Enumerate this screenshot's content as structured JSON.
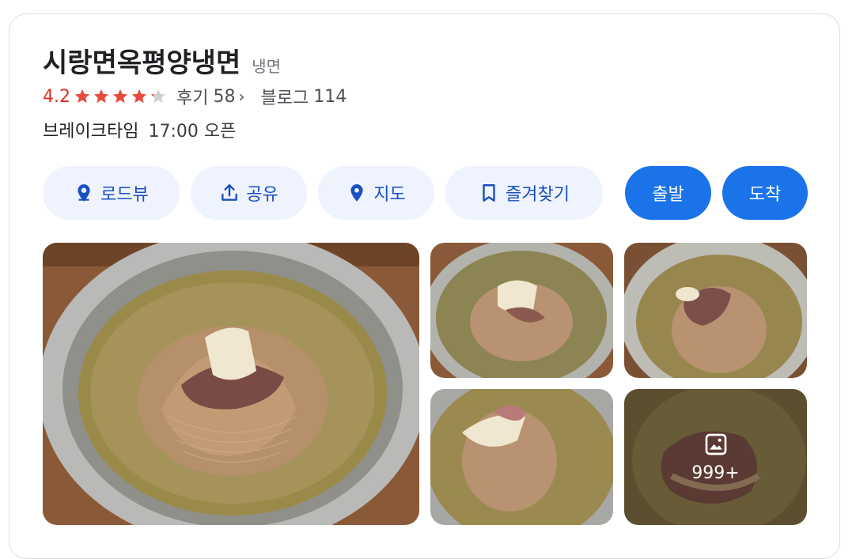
{
  "place": {
    "name": "시랑면옥평양냉면",
    "category": "냉면",
    "rating": "4.2",
    "rating_value": 4.2,
    "reviews_label": "후기",
    "reviews_count": "58",
    "blog_label": "블로그",
    "blog_count": "114",
    "hours_label": "브레이크타임",
    "hours_value": "17:00 오픈"
  },
  "actions": {
    "roadview": "로드뷰",
    "share": "공유",
    "map": "지도",
    "bookmark": "즐겨찾기",
    "depart": "출발",
    "arrive": "도착"
  },
  "photos": {
    "more_count": "999+"
  },
  "colors": {
    "accent": "#1a73e8",
    "chip_bg": "#eef3fe",
    "rating": "#d93025",
    "star": "#e84a3b"
  }
}
